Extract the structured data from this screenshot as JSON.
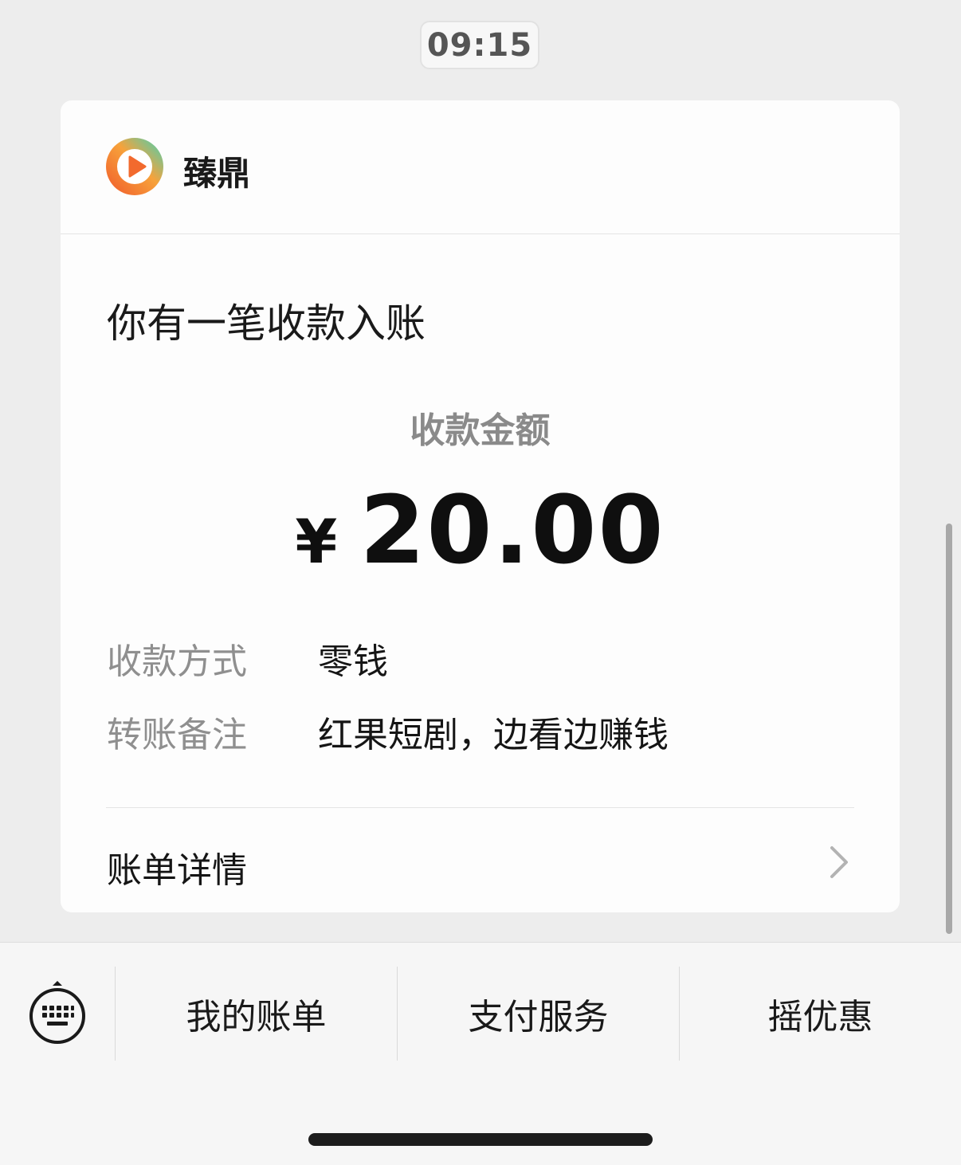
{
  "timestamp": "09:15",
  "card": {
    "merchant_name": "臻鼎",
    "logo_icon": "play-logo-icon",
    "headline": "你有一笔收款入账",
    "amount_label": "收款金额",
    "currency_symbol": "¥",
    "amount_value": "20.00",
    "details": [
      {
        "key": "收款方式",
        "value": "零钱"
      },
      {
        "key": "转账备注",
        "value": "红果短剧，边看边赚钱"
      }
    ],
    "bill_details_label": "账单详情"
  },
  "bottom_menu": {
    "keyboard_icon": "keyboard-toggle-icon",
    "items": [
      {
        "label": "我的账单"
      },
      {
        "label": "支付服务"
      },
      {
        "label": "摇优惠"
      }
    ]
  },
  "colors": {
    "background": "#ededed",
    "card": "#fdfdfd",
    "muted_text": "#8f8f8f",
    "logo_orange": "#f26a2e",
    "logo_teal": "#3fd1b8"
  }
}
